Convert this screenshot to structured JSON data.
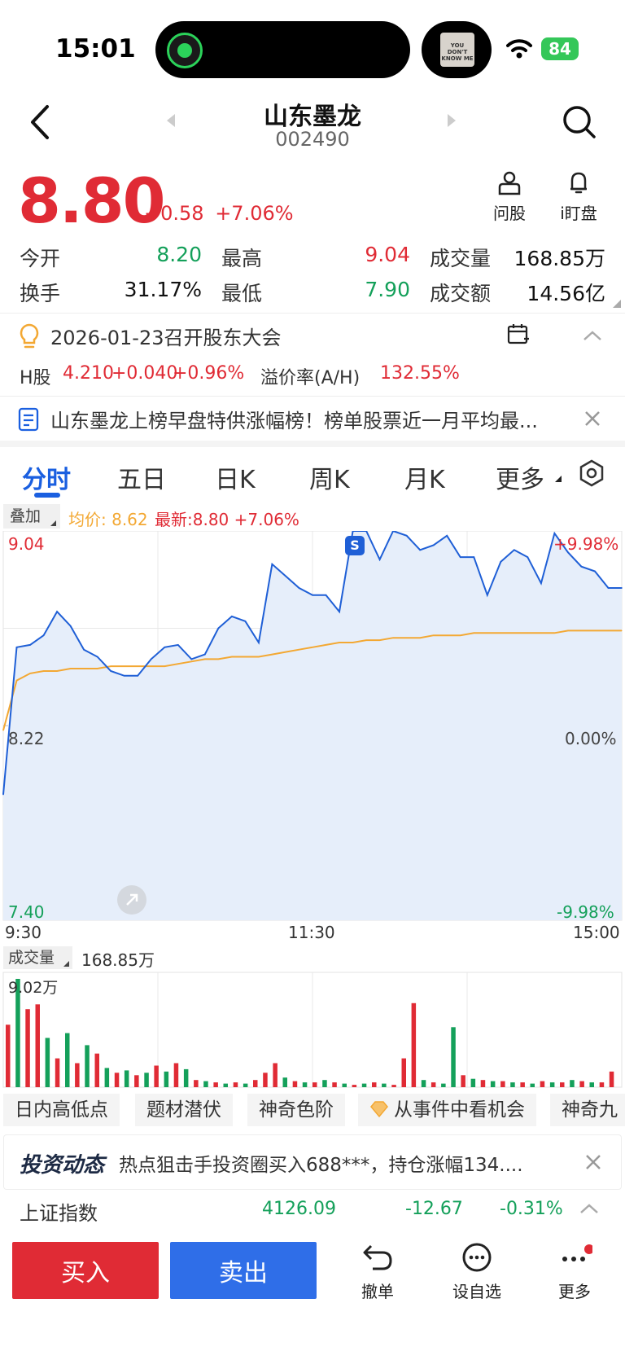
{
  "status_bar": {
    "time": "15:01",
    "battery": "84",
    "album_text": "YOU DON'T KNOW ME"
  },
  "header": {
    "title": "山东墨龙",
    "code": "002490"
  },
  "quote": {
    "price": "8.80",
    "change": "+0.58",
    "change_pct": "+7.06%",
    "tools": {
      "ask": "问股",
      "watch": "i盯盘"
    }
  },
  "stats": {
    "open_label": "今开",
    "open": "8.20",
    "high_label": "最高",
    "high": "9.04",
    "volume_label": "成交量",
    "volume": "168.85万",
    "turnover_label": "换手",
    "turnover": "31.17%",
    "low_label": "最低",
    "low": "7.90",
    "amount_label": "成交额",
    "amount": "14.56亿"
  },
  "meeting": "2026-01-23召开股东大会",
  "hshare": {
    "label": "H股",
    "price": "4.210",
    "change": "+0.040",
    "pct": "+0.96%",
    "premium_label": "溢价率(A/H)",
    "premium": "132.55%"
  },
  "news": "山东墨龙上榜早盘特供涨幅榜！榜单股票近一月平均最...",
  "tabs": [
    "分时",
    "五日",
    "日K",
    "周K",
    "月K",
    "更多"
  ],
  "chart_toolbar": {
    "overlay": "叠加",
    "avg": "均价: 8.62",
    "last": "最新:8.80 +7.06%"
  },
  "chart_axis": {
    "y_top": "9.04",
    "y_mid": "8.22",
    "y_bot": "7.40",
    "pct_top": "+9.98%",
    "pct_mid": "0.00%",
    "pct_bot": "-9.98%",
    "t_start": "9:30",
    "t_mid": "11:30",
    "t_end": "15:00",
    "marker": "S"
  },
  "volume_bar": {
    "label": "成交量",
    "total": "168.85万",
    "max": "9.02万"
  },
  "chips": [
    "日内高低点",
    "题材潜伏",
    "神奇色阶",
    "从事件中看机会",
    "神奇九"
  ],
  "dynamic": {
    "title": "投资动态",
    "text": "热点狙击手投资圈买入688***，持仓涨幅134...."
  },
  "index": {
    "name": "上证指数",
    "value": "4126.09",
    "change": "-12.67",
    "pct": "-0.31%"
  },
  "actions": {
    "buy": "买入",
    "sell": "卖出",
    "cancel": "撤单",
    "watchlist": "设自选",
    "more": "更多"
  },
  "colors": {
    "up": "#e02b35",
    "down": "#14a05a",
    "price_line": "#1f5fd6",
    "avg_line": "#f3a833",
    "accent": "#1a5fe0"
  },
  "chart_data": {
    "type": "line",
    "title": "",
    "x_labels": [
      "9:30",
      "11:30",
      "15:00"
    ],
    "ylim": [
      7.4,
      9.04
    ],
    "prev_close": 8.22,
    "series": [
      {
        "name": "最新",
        "values": [
          7.93,
          8.55,
          8.56,
          8.6,
          8.7,
          8.64,
          8.54,
          8.51,
          8.45,
          8.43,
          8.43,
          8.5,
          8.55,
          8.56,
          8.5,
          8.52,
          8.63,
          8.68,
          8.66,
          8.57,
          8.9,
          8.85,
          8.8,
          8.77,
          8.77,
          8.7,
          9.04,
          9.04,
          8.92,
          9.04,
          9.02,
          8.96,
          8.98,
          9.02,
          8.93,
          8.93,
          8.77,
          8.91,
          8.96,
          8.93,
          8.82,
          9.03,
          8.95,
          8.89,
          8.87,
          8.8,
          8.8
        ]
      },
      {
        "name": "均价",
        "values": [
          8.2,
          8.41,
          8.44,
          8.45,
          8.45,
          8.46,
          8.46,
          8.46,
          8.47,
          8.47,
          8.47,
          8.47,
          8.47,
          8.48,
          8.49,
          8.5,
          8.5,
          8.51,
          8.51,
          8.51,
          8.52,
          8.53,
          8.54,
          8.55,
          8.56,
          8.57,
          8.57,
          8.58,
          8.58,
          8.59,
          8.59,
          8.59,
          8.6,
          8.6,
          8.6,
          8.61,
          8.61,
          8.61,
          8.61,
          8.61,
          8.61,
          8.61,
          8.62,
          8.62,
          8.62,
          8.62,
          8.62
        ]
      }
    ],
    "volume": {
      "max": 9.02,
      "values": [
        5.2,
        9.02,
        6.5,
        6.9,
        4.1,
        2.4,
        4.5,
        2.0,
        3.5,
        2.8,
        1.6,
        1.2,
        1.4,
        1.0,
        1.2,
        1.8,
        1.3,
        2.0,
        1.5,
        0.6,
        0.5,
        0.4,
        0.3,
        0.4,
        0.3,
        0.6,
        1.2,
        2.0,
        0.8,
        0.5,
        0.4,
        0.4,
        0.6,
        0.4,
        0.3,
        0.2,
        0.3,
        0.4,
        0.3,
        0.2,
        2.4,
        7.0,
        0.6,
        0.4,
        0.3,
        5.0,
        1.0,
        0.7,
        0.6,
        0.5,
        0.5,
        0.4,
        0.4,
        0.3,
        0.5,
        0.4,
        0.4,
        0.6,
        0.5,
        0.4,
        0.4,
        1.3
      ],
      "colors": [
        "r",
        "g",
        "r",
        "r",
        "g",
        "r",
        "g",
        "r",
        "g",
        "r",
        "g",
        "r",
        "g",
        "r",
        "g",
        "r",
        "g",
        "r",
        "g",
        "r",
        "g",
        "r",
        "g",
        "r",
        "g",
        "r",
        "r",
        "r",
        "g",
        "r",
        "g",
        "r",
        "g",
        "r",
        "g",
        "r",
        "g",
        "r",
        "g",
        "r",
        "r",
        "r",
        "g",
        "r",
        "g",
        "g",
        "r",
        "g",
        "r",
        "g",
        "r",
        "g",
        "r",
        "g",
        "r",
        "g",
        "r",
        "g",
        "r",
        "g",
        "r",
        "r"
      ]
    }
  }
}
